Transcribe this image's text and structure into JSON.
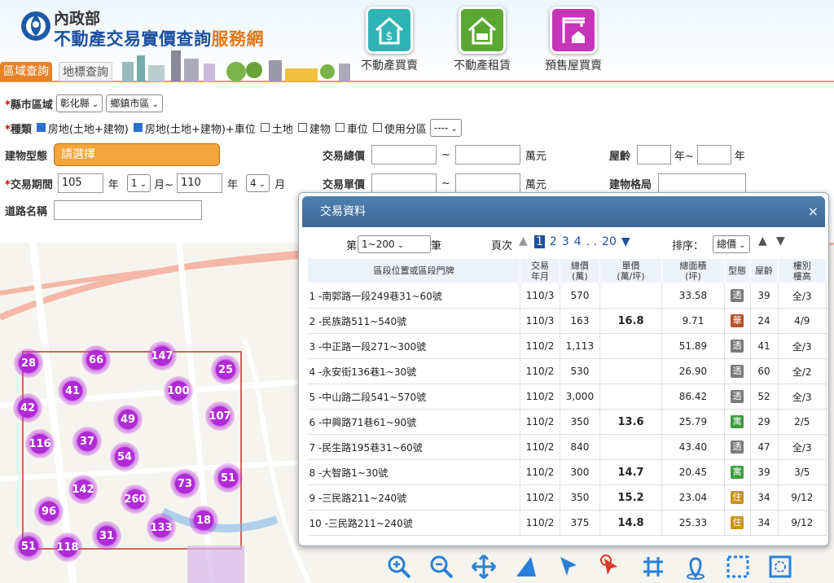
{
  "header": {
    "ministry": "內政部",
    "site_title_main": "不動產交易實價查詢",
    "site_title_accent": "服務網",
    "tabs": [
      "區域查詢",
      "地標查詢"
    ],
    "nav": [
      {
        "label": "不動產買賣",
        "color": "#2fb4b4"
      },
      {
        "label": "不動產租賃",
        "color": "#5aa832"
      },
      {
        "label": "預售屋買賣",
        "color": "#c634b8"
      }
    ]
  },
  "form": {
    "county_label": "縣市區域",
    "county": "彰化縣",
    "town": "鄉鎮市區",
    "kind_label": "種類",
    "kinds": [
      {
        "label": "房地(土地+建物)",
        "checked": true
      },
      {
        "label": "房地(土地+建物)+車位",
        "checked": true
      },
      {
        "label": "土地",
        "checked": false
      },
      {
        "label": "建物",
        "checked": false
      },
      {
        "label": "車位",
        "checked": false
      },
      {
        "label": "使用分區",
        "checked": false
      }
    ],
    "zone_select": "----",
    "building_type_label": "建物型態",
    "building_type": "請選擇",
    "total_price_label": "交易總價",
    "unit_price_label": "交易單價",
    "wan": "萬元",
    "tilde": "~",
    "age_label": "屋齡",
    "year_unit": "年",
    "year_unit_tilde": "年~",
    "period_label": "交易期間",
    "from_year": "105",
    "from_month": "1",
    "to_year": "110",
    "to_month": "4",
    "month_unit": "月",
    "month_unit_tilde": "月~",
    "layout_label": "建物格局",
    "road_label": "道路名稱"
  },
  "map": {
    "clusters": [
      "28",
      "66",
      "147",
      "25",
      "41",
      "100",
      "42",
      "107",
      "49",
      "116",
      "37",
      "54",
      "51",
      "73",
      "142",
      "260",
      "96",
      "18",
      "133",
      "31",
      "51",
      "118"
    ]
  },
  "panel": {
    "title": "交易資料",
    "close": "×",
    "records_prefix": "第",
    "records_range": "1~200",
    "records_suffix": "筆",
    "page_label": "頁次",
    "pages": [
      "1",
      "2",
      "3",
      "4",
      ". .",
      "20"
    ],
    "sort_label": "排序：",
    "sort": "總價",
    "columns": [
      "區段位置或區段門牌",
      "交易\n年月",
      "總價\n(萬)",
      "單價\n(萬/坪)",
      "總面積\n(坪)",
      "型態",
      "屋齡",
      "樓別\n樓高"
    ],
    "rows": [
      [
        "1 -南郭路一段249巷31~60號",
        "110/3",
        "570",
        "",
        "33.58",
        "透",
        "39",
        "全/3"
      ],
      [
        "2 -民族路511~540號",
        "110/3",
        "163",
        "16.8",
        "9.71",
        "華",
        "24",
        "4/9"
      ],
      [
        "3 -中正路一段271~300號",
        "110/2",
        "1,113",
        "",
        "51.89",
        "透",
        "41",
        "全/3"
      ],
      [
        "4 -永安街136巷1~30號",
        "110/2",
        "530",
        "",
        "26.90",
        "透",
        "60",
        "全/2"
      ],
      [
        "5 -中山路二段541~570號",
        "110/2",
        "3,000",
        "",
        "86.42",
        "透",
        "52",
        "全/3"
      ],
      [
        "6 -中興路71巷61~90號",
        "110/2",
        "350",
        "13.6",
        "25.79",
        "寓",
        "29",
        "2/5"
      ],
      [
        "7 -民生路195巷31~60號",
        "110/2",
        "840",
        "",
        "43.40",
        "透",
        "47",
        "全/3"
      ],
      [
        "8 -大智路1~30號",
        "110/2",
        "300",
        "14.7",
        "20.45",
        "寓",
        "39",
        "3/5"
      ],
      [
        "9 -三民路211~240號",
        "110/2",
        "350",
        "15.2",
        "23.04",
        "住",
        "34",
        "9/12"
      ],
      [
        "10 -三民路211~240號",
        "110/2",
        "375",
        "14.8",
        "25.33",
        "住",
        "34",
        "9/12"
      ]
    ],
    "badge_colors": {
      "透": "#7a7a7a",
      "華": "#b5532a",
      "寓": "#3e9a3e",
      "住": "#c8941a"
    }
  },
  "toolbar": [
    "zoom-in-icon",
    "zoom-out-icon",
    "pan-icon",
    "measure-area-icon",
    "select-icon",
    "pointer-icon",
    "grid-icon",
    "locate-icon",
    "select-box-icon",
    "clear-icon"
  ]
}
